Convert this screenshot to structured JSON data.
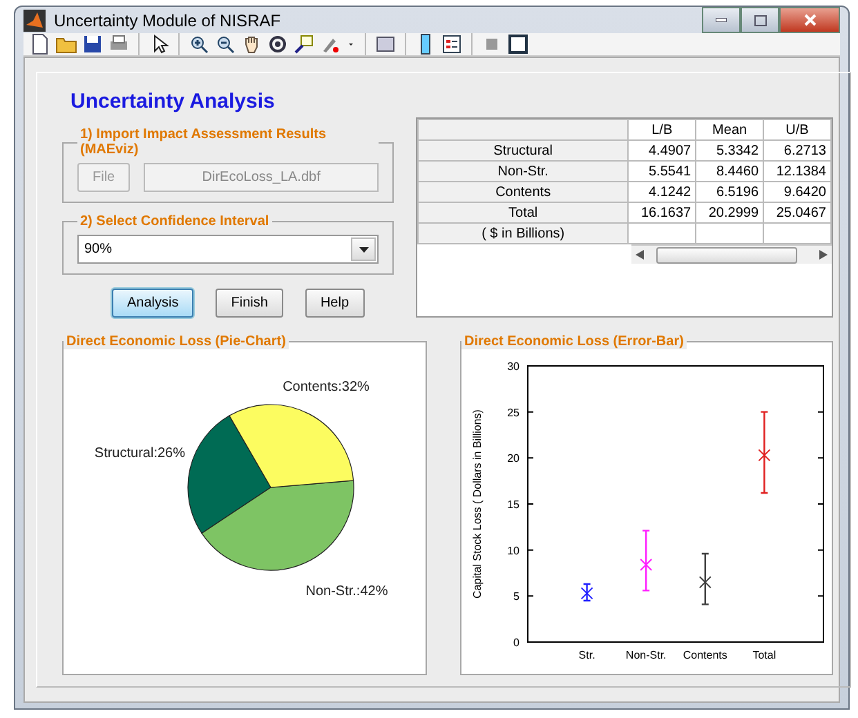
{
  "window": {
    "title": "Uncertainty Module of NISRAF"
  },
  "heading": "Uncertainty Analysis",
  "import_group": {
    "title": "1) Import Impact Assessment Results (MAEviz)",
    "file_button": {
      "label": "File",
      "disabled": true
    },
    "file_field": {
      "value": "DirEcoLoss_LA.dbf",
      "disabled": true
    }
  },
  "confidence_group": {
    "title": "2) Select Confidence Interval",
    "dropdown": {
      "value": "90%"
    }
  },
  "buttons": [
    {
      "label": "Analysis",
      "selected": true
    },
    {
      "label": "Finish",
      "selected": false
    },
    {
      "label": "Help",
      "selected": false
    }
  ],
  "table": {
    "columns": [
      "L/B",
      "Mean",
      "U/B"
    ],
    "rows": [
      {
        "label": "Structural",
        "cells": [
          "4.4907",
          "5.3342",
          "6.2713"
        ]
      },
      {
        "label": "Non-Str.",
        "cells": [
          "5.5541",
          "8.4460",
          "12.1384"
        ]
      },
      {
        "label": "Contents",
        "cells": [
          "4.1242",
          "6.5196",
          "9.6420"
        ]
      },
      {
        "label": "Total",
        "cells": [
          "16.1637",
          "20.2999",
          "25.0467"
        ]
      },
      {
        "label": "( $ in Billions)"
      }
    ]
  },
  "pie_panel": {
    "title": "Direct Economic Loss (Pie-Chart)",
    "chart_data": {
      "type": "pie",
      "categories": [
        "Structural:26%",
        "Non-Str.:42%",
        "Contents:32%"
      ],
      "values": [
        26,
        42,
        32
      ],
      "colors": [
        "#006b54",
        "#7ec464",
        "#fcfc60"
      ]
    }
  },
  "error_panel": {
    "title": "Direct Economic Loss (Error-Bar)",
    "chart_data": {
      "type": "scatter",
      "categories": [
        "Str.",
        "Non-Str.",
        "Contents",
        "Total"
      ],
      "ylabel": "Capital Stock Loss ( Dollars in Billions)",
      "ylim": [
        0,
        30
      ],
      "yticks": [
        0,
        5,
        10,
        15,
        20,
        25,
        30
      ],
      "series": [
        {
          "values": [
            5.3,
            8.4,
            6.5,
            20.3
          ],
          "colors": [
            "#2020ff",
            "#ff20ff",
            "#404040",
            "#e02020"
          ],
          "errors": [
            [
              4.5,
              6.3
            ],
            [
              5.6,
              12.1
            ],
            [
              4.1,
              9.6
            ],
            [
              16.2,
              25.0
            ]
          ]
        }
      ]
    }
  }
}
